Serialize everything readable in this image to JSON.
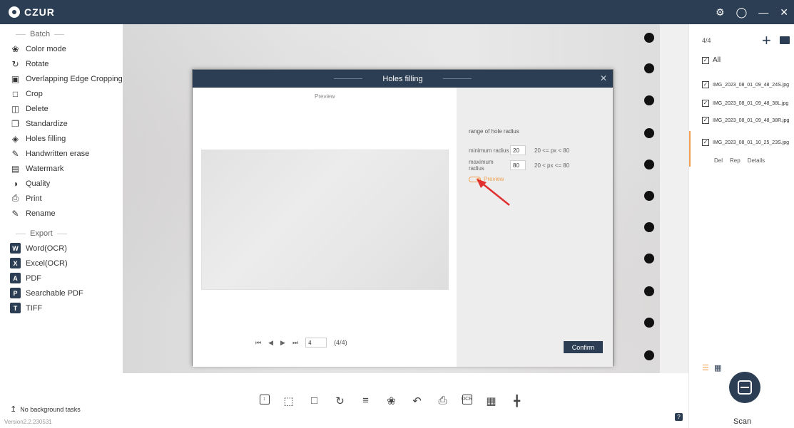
{
  "app": {
    "logo_text": "CZUR",
    "window_controls": [
      "settings-icon",
      "help-icon",
      "minimize-icon",
      "close-icon"
    ]
  },
  "sidebar": {
    "batch_header": "Batch",
    "items": [
      {
        "label": "Color mode",
        "icon": "color-mode-icon"
      },
      {
        "label": "Rotate",
        "icon": "rotate-icon"
      },
      {
        "label": "Overlapping Edge Cropping",
        "icon": "overlap-crop-icon"
      },
      {
        "label": "Crop",
        "icon": "crop-icon"
      },
      {
        "label": "Delete",
        "icon": "delete-icon"
      },
      {
        "label": "Standardize",
        "icon": "standardize-icon"
      },
      {
        "label": "Holes filling",
        "icon": "holes-filling-icon"
      },
      {
        "label": "Handwritten erase",
        "icon": "handwritten-erase-icon"
      },
      {
        "label": "Watermark",
        "icon": "watermark-icon"
      },
      {
        "label": "Quality",
        "icon": "quality-icon"
      },
      {
        "label": "Print",
        "icon": "print-icon"
      },
      {
        "label": "Rename",
        "icon": "rename-icon"
      }
    ],
    "export_header": "Export",
    "export_items": [
      {
        "label": "Word(OCR)",
        "icon": "word-icon",
        "glyph": "W"
      },
      {
        "label": "Excel(OCR)",
        "icon": "excel-icon",
        "glyph": "X"
      },
      {
        "label": "PDF",
        "icon": "pdf-icon",
        "glyph": "A"
      },
      {
        "label": "Searchable PDF",
        "icon": "searchable-pdf-icon",
        "glyph": "P"
      },
      {
        "label": "TIFF",
        "icon": "tiff-icon",
        "glyph": "T"
      }
    ],
    "background_tasks": "No background tasks",
    "version": "Version2.2.230531"
  },
  "right_panel": {
    "count": "4/4",
    "all_label": "All",
    "files": [
      {
        "name": "IMG_2023_08_01_09_48_24S.jpg",
        "checked": true
      },
      {
        "name": "IMG_2023_08_01_09_48_38L.jpg",
        "checked": true
      },
      {
        "name": "IMG_2023_08_01_09_48_38R.jpg",
        "checked": true
      },
      {
        "name": "IMG_2023_08_01_10_25_23S.jpg",
        "checked": true
      }
    ],
    "file_actions": [
      "Del",
      "Rep",
      "Details"
    ],
    "scan_label": "Scan",
    "accent_color": "#f0a050"
  },
  "dialog": {
    "title": "Holes filling",
    "preview_label": "Preview",
    "range_label": "range of hole radius",
    "min_label": "minimum radius",
    "min_value": "20",
    "min_range": "20 <= px < 80",
    "max_label": "maximum radius",
    "max_value": "80",
    "max_range": "20 < px <= 80",
    "preview_toggle_label": "Preview",
    "page_value": "4",
    "page_total": "(4/4)",
    "confirm_label": "Confirm"
  },
  "colors": {
    "brand_dark": "#2c3e53",
    "accent": "#f0a050",
    "annotation_arrow": "#e03030"
  }
}
